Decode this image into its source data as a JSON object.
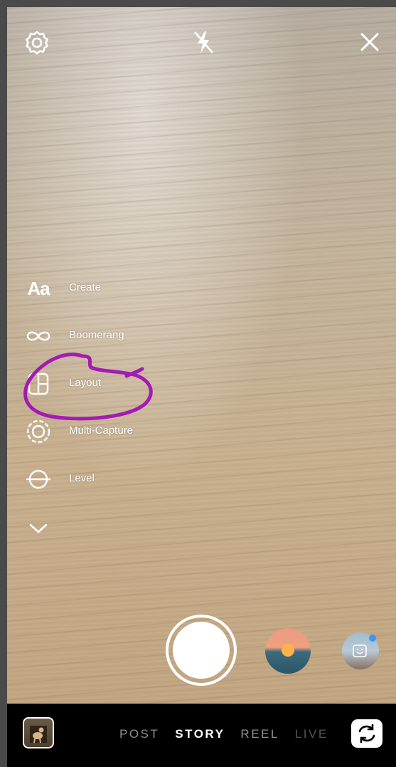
{
  "top_bar": {
    "settings_icon": "settings-gear-icon",
    "flash_icon": "flash-off-icon",
    "close_icon": "close-icon"
  },
  "creative_tools": {
    "items": [
      {
        "label": "Create",
        "icon": "text-aa-icon",
        "icon_text": "Aa"
      },
      {
        "label": "Boomerang",
        "icon": "infinity-icon"
      },
      {
        "label": "Layout",
        "icon": "layout-grid-icon"
      },
      {
        "label": "Multi-Capture",
        "icon": "multi-capture-icon"
      },
      {
        "label": "Level",
        "icon": "level-icon"
      }
    ],
    "more_icon": "chevron-down-icon"
  },
  "annotation": {
    "color": "#a31bb3",
    "note": "hand-drawn circle around Layout"
  },
  "capture": {
    "shutter": "shutter-button",
    "filter_thumb": "sunset-filter-thumbnail",
    "effect_thumb": "effect-face-thumbnail",
    "effect_dot_color": "#3897f0"
  },
  "bottom_bar": {
    "gallery_icon": "gallery-thumbnail",
    "tabs": [
      "POST",
      "STORY",
      "REEL",
      "LIVE"
    ],
    "active_tab": "STORY",
    "flip_icon": "flip-camera-icon"
  }
}
